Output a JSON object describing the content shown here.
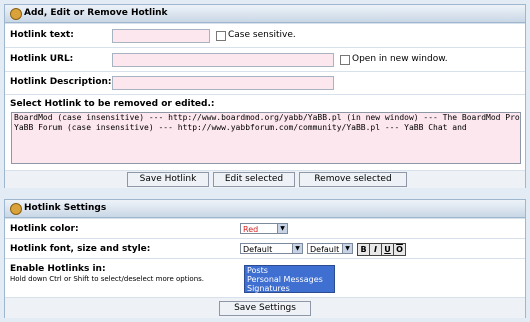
{
  "hotlink": {
    "title": "Add, Edit or Remove Hotlink",
    "text_label": "Hotlink text:",
    "case_label": "Case sensitive.",
    "url_label": "Hotlink URL:",
    "newwin_label": "Open in new window.",
    "desc_label": "Hotlink Description:",
    "select_label": "Select Hotlink to be removed or edited.:",
    "list": [
      "BoardMod (case insensitive) --- http://www.boardmod.org/yabb/YaBB.pl (in new window) --- The BoardMod Project",
      "YaBB Forum (case insensitive) --- http://www.yabbforum.com/community/YaBB.pl --- YaBB Chat and"
    ],
    "save_btn": "Save Hotlink",
    "edit_btn": "Edit selected",
    "remove_btn": "Remove selected"
  },
  "settings": {
    "title": "Hotlink Settings",
    "color_label": "Hotlink color:",
    "color_value": "Red",
    "color_hex": "#d22222",
    "font_label": "Hotlink font, size and style:",
    "font_value": "Default",
    "size_value": "Default",
    "fmt_buttons": [
      "B",
      "I",
      "U",
      "O"
    ],
    "enable_label": "Enable Hotlinks in:",
    "enable_help": "Hold down Ctrl or Shift to select/deselect more options.",
    "enable_options": [
      "Posts",
      "Personal Messages",
      "Signatures"
    ],
    "save_btn": "Save Settings"
  }
}
